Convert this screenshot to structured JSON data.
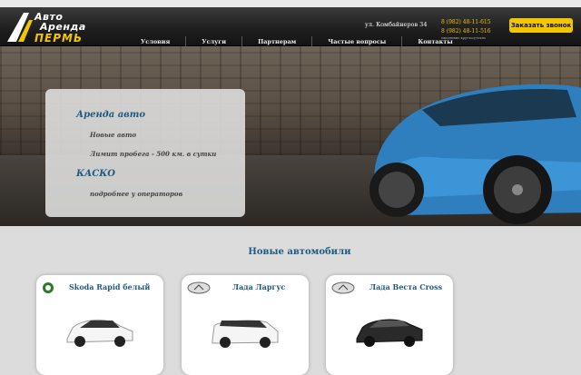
{
  "header": {
    "logo": {
      "line1": "Авто",
      "line2": "Аренда",
      "line3": "ПЕРМЬ"
    },
    "address": "ул. Комбайнеров 34",
    "phones": [
      "8 (982) 48-11-615",
      "8 (982) 48-11-516"
    ],
    "phone_note": "ежедневно круглосуточно",
    "callback_label": "Заказать звонок"
  },
  "nav": [
    "Условия",
    "Услуги",
    "Партнерам",
    "Частые вопросы",
    "Контакты"
  ],
  "hero": {
    "title1": "Аренда авто",
    "line1": "Новые авто",
    "line2": "Лимит пробега - 500 км. в сутки",
    "title2": "КАСКО",
    "line3": "подробнее у операторов",
    "slides": 5,
    "active_slide": 1
  },
  "section": {
    "title": "Новые автомобили"
  },
  "cars": [
    {
      "name": "Skoda Rapid белый",
      "brand_icon": "skoda-logo-icon",
      "color": "#ffffff"
    },
    {
      "name": "Лада Ларгус",
      "brand_icon": "lada-logo-icon",
      "color": "#ffffff"
    },
    {
      "name": "Лада Веста Cross",
      "brand_icon": "lada-logo-icon",
      "color": "#2a2a2a"
    }
  ],
  "colors": {
    "accent": "#f2c600",
    "title_blue": "#1d5a82"
  }
}
